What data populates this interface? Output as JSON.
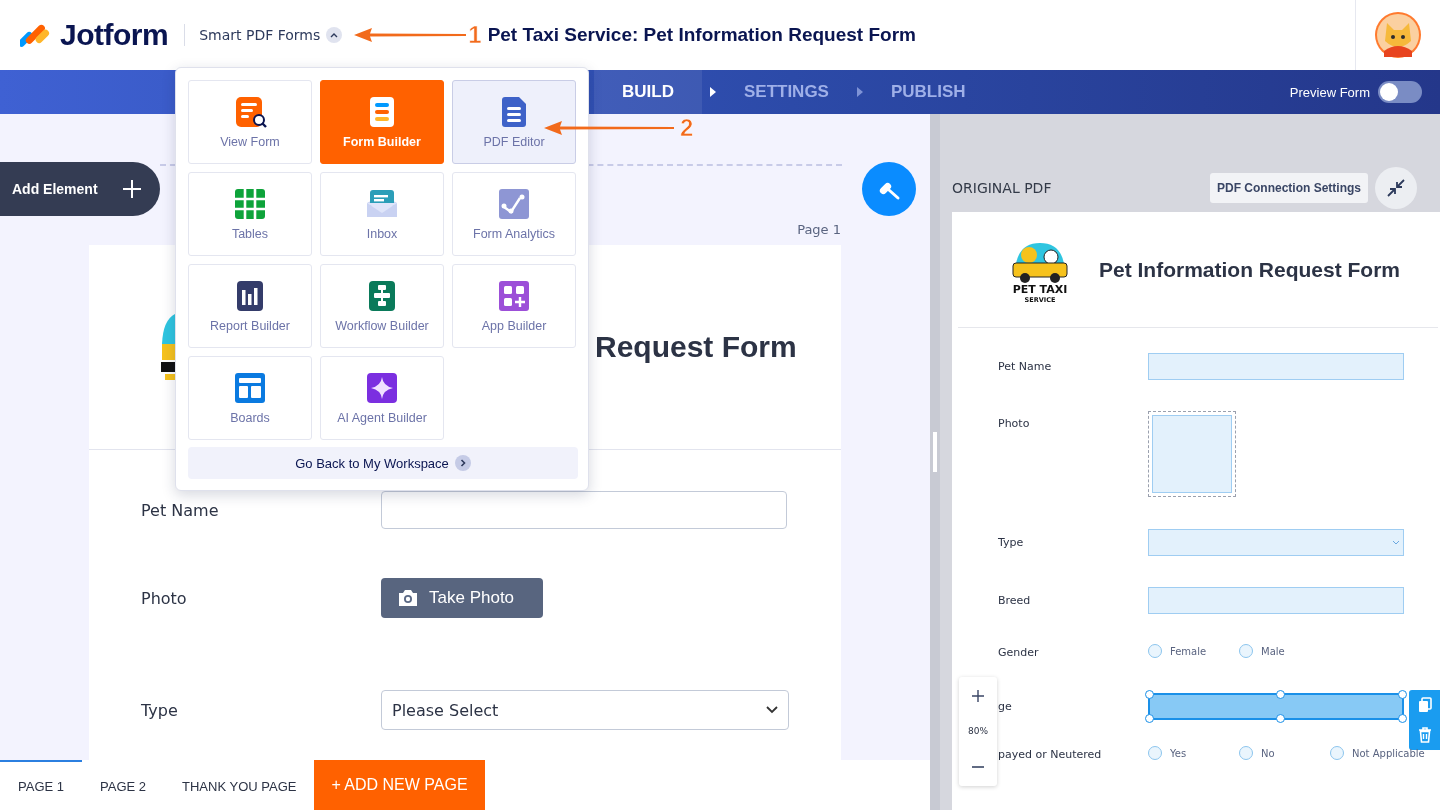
{
  "header": {
    "brand": "Jotform",
    "product": "Smart PDF Forms",
    "form_title": "Pet Taxi Service: Pet Information Request Form"
  },
  "nav": {
    "tabs": [
      {
        "label": "BUILD",
        "selected": true
      },
      {
        "label": "SETTINGS",
        "selected": false
      },
      {
        "label": "PUBLISH",
        "selected": false
      }
    ],
    "preview": {
      "label": "Preview Form",
      "on": false
    }
  },
  "app_menu": {
    "items": [
      {
        "label": "View Form",
        "selected": false,
        "highlighted": false
      },
      {
        "label": "Form Builder",
        "selected": true,
        "highlighted": false
      },
      {
        "label": "PDF Editor",
        "selected": false,
        "highlighted": true
      },
      {
        "label": "Tables",
        "selected": false,
        "highlighted": false
      },
      {
        "label": "Inbox",
        "selected": false,
        "highlighted": false
      },
      {
        "label": "Form Analytics",
        "selected": false,
        "highlighted": false
      },
      {
        "label": "Report Builder",
        "selected": false,
        "highlighted": false
      },
      {
        "label": "Workflow Builder",
        "selected": false,
        "highlighted": false
      },
      {
        "label": "App Builder",
        "selected": false,
        "highlighted": false
      },
      {
        "label": "Boards",
        "selected": false,
        "highlighted": false
      },
      {
        "label": "AI Agent Builder",
        "selected": false,
        "highlighted": false
      }
    ],
    "footer": "Go Back to My Workspace"
  },
  "annotations": [
    {
      "label": "1"
    },
    {
      "label": "2"
    }
  ],
  "builder": {
    "add_element": "Add Element",
    "page_label": "Page 1",
    "form_title_visible": "Request Form",
    "fields": [
      {
        "kind": "text",
        "label": "Pet Name"
      },
      {
        "kind": "photo",
        "label": "Photo",
        "button": "Take Photo"
      },
      {
        "kind": "select",
        "label": "Type",
        "placeholder": "Please Select"
      }
    ],
    "pages": [
      {
        "label": "PAGE 1",
        "selected": true
      },
      {
        "label": "PAGE 2",
        "selected": false
      },
      {
        "label": "THANK YOU PAGE",
        "selected": false
      }
    ],
    "add_page": "+ ADD NEW PAGE"
  },
  "pdf": {
    "heading": "ORIGINAL PDF",
    "settings_button": "PDF Connection Settings",
    "logo_text": [
      "PET TAXI",
      "SERVICE"
    ],
    "title": "Pet Information Request Form",
    "zoom": "80%",
    "fields": [
      {
        "kind": "text",
        "label": "Pet Name",
        "selected": false
      },
      {
        "kind": "photo",
        "label": "Photo",
        "selected": false
      },
      {
        "kind": "select",
        "label": "Type",
        "selected": false
      },
      {
        "kind": "text",
        "label": "Breed",
        "selected": false
      },
      {
        "kind": "radio",
        "label": "Gender",
        "options": [
          "Female",
          "Male"
        ],
        "selected": false
      },
      {
        "kind": "text",
        "label": "ge",
        "selected": true
      },
      {
        "kind": "radio",
        "label": "payed or Neutered",
        "options": [
          "Yes",
          "No",
          "Not Applicable"
        ],
        "selected": false
      }
    ]
  }
}
